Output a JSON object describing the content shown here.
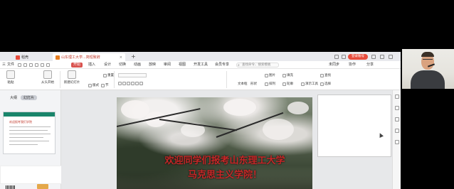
{
  "tabs": {
    "home": "稻壳",
    "document": "山东理工大学...简短致辞",
    "new_tab": "+"
  },
  "topright": {
    "badge": "登录账号"
  },
  "menu": {
    "items": [
      "三",
      "文件",
      "",
      "",
      "",
      "",
      "",
      "开始",
      "插入",
      "设计",
      "切换",
      "动画",
      "放映",
      "审阅",
      "视图",
      "开发工具",
      "会员专享"
    ],
    "active_index": 7,
    "search": "查找命令、搜索模板",
    "right": [
      "未同步",
      "协作",
      "分享"
    ]
  },
  "ribbon": {
    "paste": "粘贴",
    "from_start": "从头开始",
    "new_slide": "新建幻灯片",
    "layout": "版式",
    "section": "节",
    "reset": "重置",
    "textbox": "文本框",
    "shape": "形状",
    "arrange": "排列",
    "picture": "图片",
    "fill": "填充",
    "outline": "轮廓",
    "format_painter": "演示工具",
    "find": "查找",
    "replace": "替换",
    "select": "选择"
  },
  "leftpane": {
    "tabs": [
      "大纲",
      "幻灯片"
    ],
    "selected_tab": 1,
    "thumb_title": "欢迎报考我们学院"
  },
  "slide": {
    "line1": "欢迎同学们报考山东理工大学",
    "line2": "马克思主义学院！"
  },
  "colors": {
    "accent": "#d9534f",
    "title_red": "#c62828",
    "thumb_bar": "#19856b"
  }
}
